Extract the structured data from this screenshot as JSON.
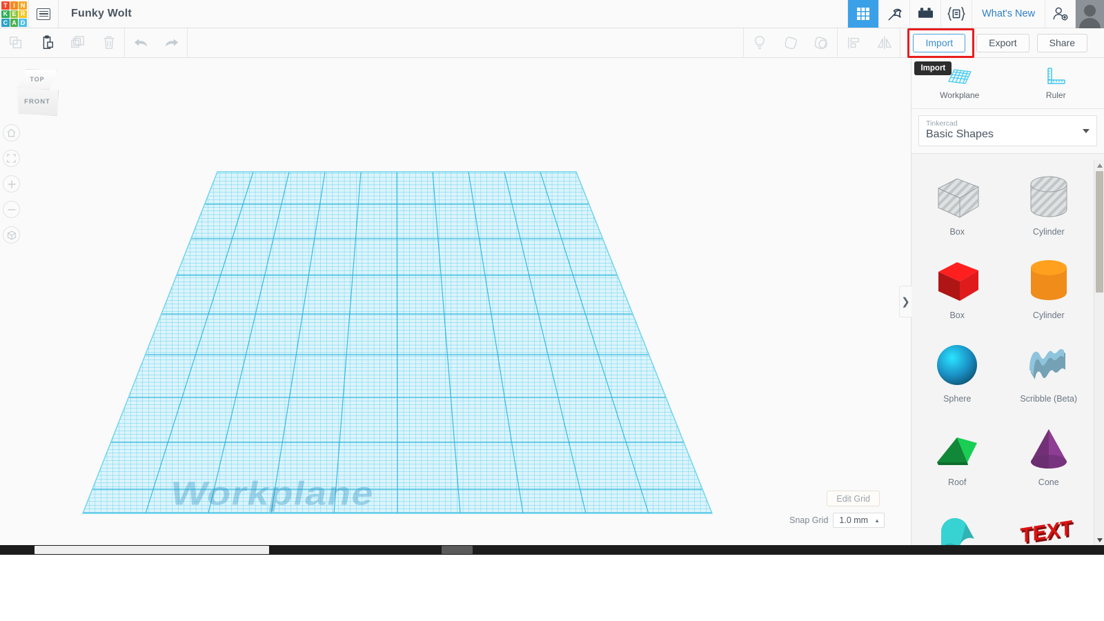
{
  "app": {
    "brand_letters": [
      {
        "char": "T",
        "color": "#f0492c"
      },
      {
        "char": "I",
        "color": "#f58a1f"
      },
      {
        "char": "N",
        "color": "#f5a623"
      },
      {
        "char": "K",
        "color": "#2fae57"
      },
      {
        "char": "E",
        "color": "#8cc63e"
      },
      {
        "char": "R",
        "color": "#f5c518"
      },
      {
        "char": "C",
        "color": "#2aa3c7"
      },
      {
        "char": "A",
        "color": "#4cb050"
      },
      {
        "char": "D",
        "color": "#4ec0e6"
      }
    ],
    "project_title": "Funky Wolt"
  },
  "topbar": {
    "icons": [
      {
        "name": "gallery-grid-icon",
        "active": true
      },
      {
        "name": "pickaxe-icon",
        "active": false
      },
      {
        "name": "lego-brick-icon",
        "active": false
      },
      {
        "name": "codeblocks-icon",
        "active": false
      }
    ],
    "whats_new_label": "What's New",
    "add_user_label": "add-user-icon",
    "avatar_label": "avatar"
  },
  "toolbar": {
    "left_tools": [
      {
        "name": "copy-button",
        "label": "Copy",
        "enabled": false
      },
      {
        "name": "paste-button",
        "label": "Paste",
        "enabled": true
      },
      {
        "name": "duplicate-button",
        "label": "Duplicate",
        "enabled": false
      },
      {
        "name": "delete-button",
        "label": "Delete",
        "enabled": false
      },
      {
        "name": "undo-button",
        "label": "Undo",
        "enabled": false
      },
      {
        "name": "redo-button",
        "label": "Redo",
        "enabled": false
      }
    ],
    "right_tools": [
      {
        "name": "lightbulb-button",
        "label": "Notes"
      },
      {
        "name": "group-button",
        "label": "Group"
      },
      {
        "name": "ungroup-button",
        "label": "Ungroup"
      },
      {
        "name": "align-button",
        "label": "Align"
      },
      {
        "name": "mirror-button",
        "label": "Mirror"
      }
    ],
    "import_label": "Import",
    "export_label": "Export",
    "share_label": "Share",
    "tooltip_text": "Import",
    "highlight_color": "#e81d1d",
    "focus_color": "#4aa3e0"
  },
  "canvas": {
    "viewcube": {
      "top_face": "TOP",
      "front_face": "FRONT"
    },
    "nav_buttons": [
      {
        "name": "home-view-button",
        "glyph": "home-icon"
      },
      {
        "name": "fit-to-view-button",
        "glyph": "fit-icon"
      },
      {
        "name": "zoom-in-button",
        "glyph": "plus-icon"
      },
      {
        "name": "zoom-out-button",
        "glyph": "minus-icon"
      },
      {
        "name": "ortho-perspective-toggle",
        "glyph": "cube-icon"
      }
    ],
    "workplane_label": "Workplane",
    "grid_color": "#5fd0ef",
    "grid_major_color": "#2eb4dc",
    "edit_grid_label": "Edit Grid",
    "snap_grid_label": "Snap Grid",
    "snap_grid_value": "1.0 mm"
  },
  "panel": {
    "tools": [
      {
        "name": "workplane-tool",
        "label": "Workplane",
        "icon": "workplane-icon"
      },
      {
        "name": "ruler-tool",
        "label": "Ruler",
        "icon": "ruler-icon"
      }
    ],
    "library_sub": "Tinkercad",
    "library_name": "Basic Shapes",
    "collapse_glyph": "❯",
    "shapes": [
      {
        "name": "shape-box-hole",
        "label": "Box",
        "art": "box",
        "color": "#c9ccce",
        "hole": true
      },
      {
        "name": "shape-cylinder-hole",
        "label": "Cylinder",
        "art": "cylinder",
        "color": "#c9ccce",
        "hole": true
      },
      {
        "name": "shape-box-red",
        "label": "Box",
        "art": "box",
        "color": "#e01b1b",
        "hole": false
      },
      {
        "name": "shape-cylinder-orange",
        "label": "Cylinder",
        "art": "cylinder",
        "color": "#f08c1a",
        "hole": false
      },
      {
        "name": "shape-sphere",
        "label": "Sphere",
        "art": "sphere",
        "color": "#1a8fc4",
        "hole": false
      },
      {
        "name": "shape-scribble",
        "label": "Scribble (Beta)",
        "art": "scribble",
        "color": "#8fc4dd",
        "hole": false
      },
      {
        "name": "shape-roof",
        "label": "Roof",
        "art": "roof",
        "color": "#16b84a",
        "hole": false
      },
      {
        "name": "shape-cone",
        "label": "Cone",
        "art": "cone",
        "color": "#8e3d94",
        "hole": false
      },
      {
        "name": "shape-round-roof",
        "label": "",
        "art": "roundroof",
        "color": "#2fb3b3",
        "hole": false
      },
      {
        "name": "shape-text",
        "label": "",
        "art": "text",
        "color": "#d81414",
        "hole": false
      }
    ]
  }
}
